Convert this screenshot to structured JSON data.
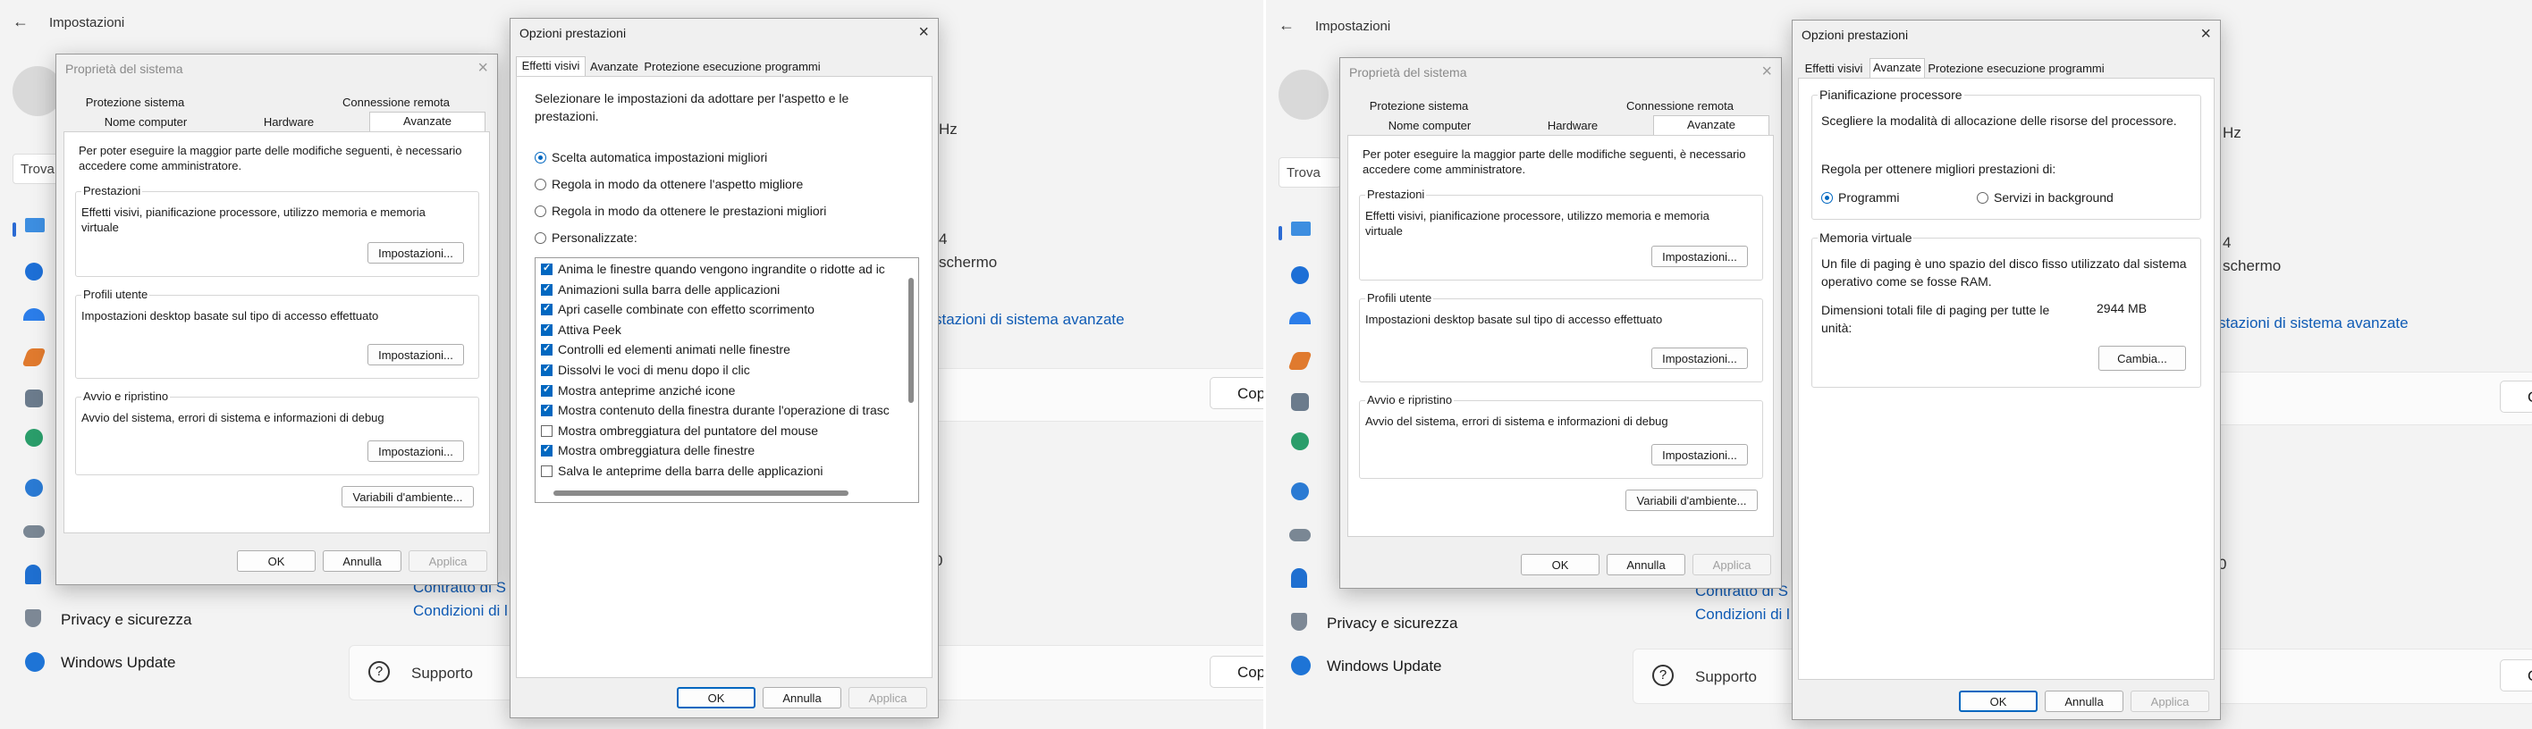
{
  "settings": {
    "title": "Impostazioni",
    "search_text": "Trova",
    "partial_hz": "Hz",
    "partial_4": "4",
    "partial_schermo": "schermo",
    "link_advanced": "stazioni di sistema avanzate",
    "copy_label": "Copi",
    "copy_label_short": "C",
    "partial_0": "0",
    "link_contract": "Contratto di S",
    "link_conditions": "Condizioni di l",
    "nav": {
      "privacy": "Privacy e sicurezza",
      "update": "Windows Update",
      "support": "Supporto"
    }
  },
  "system_properties": {
    "title": "Proprietà del sistema",
    "tabs": {
      "protection": "Protezione sistema",
      "remote": "Connessione remota",
      "computer_name": "Nome computer",
      "hardware": "Hardware",
      "advanced": "Avanzate"
    },
    "admin_note": "Per poter eseguire la maggior parte delle modifiche seguenti, è necessario accedere come amministratore.",
    "performance": {
      "label": "Prestazioni",
      "desc": "Effetti visivi, pianificazione processore, utilizzo memoria e memoria virtuale",
      "button": "Impostazioni..."
    },
    "user_profiles": {
      "label": "Profili utente",
      "desc": "Impostazioni desktop basate sul tipo di accesso effettuato",
      "button": "Impostazioni..."
    },
    "startup": {
      "label": "Avvio e ripristino",
      "desc": "Avvio del sistema, errori di sistema e informazioni di debug",
      "button": "Impostazioni..."
    },
    "env_button": "Variabili d'ambiente...",
    "ok": "OK",
    "cancel": "Annulla",
    "apply": "Applica"
  },
  "performance_options": {
    "title": "Opzioni prestazioni",
    "tabs": {
      "visual": "Effetti visivi",
      "advanced": "Avanzate",
      "dep": "Protezione esecuzione programmi"
    },
    "visual": {
      "intro": "Selezionare le impostazioni da adottare per l'aspetto e le prestazioni.",
      "radio_auto": "Scelta automatica impostazioni migliori",
      "radio_look": "Regola in modo da ottenere l'aspetto migliore",
      "radio_perf": "Regola in modo da ottenere le prestazioni migliori",
      "radio_custom": "Personalizzate:",
      "items": [
        {
          "label": "Anima le finestre quando vengono ingrandite o ridotte ad ic",
          "checked": true
        },
        {
          "label": "Animazioni sulla barra delle applicazioni",
          "checked": true
        },
        {
          "label": "Apri caselle combinate con effetto scorrimento",
          "checked": true
        },
        {
          "label": "Attiva Peek",
          "checked": true
        },
        {
          "label": "Controlli ed elementi animati nelle finestre",
          "checked": true
        },
        {
          "label": "Dissolvi le voci di menu dopo il clic",
          "checked": true
        },
        {
          "label": "Mostra anteprime anziché icone",
          "checked": true
        },
        {
          "label": "Mostra contenuto della finestra durante l'operazione di trasc",
          "checked": true
        },
        {
          "label": "Mostra ombreggiatura del puntatore del mouse",
          "checked": false
        },
        {
          "label": "Mostra ombreggiatura delle finestre",
          "checked": true
        },
        {
          "label": "Salva le anteprime della barra delle applicazioni",
          "checked": false
        }
      ]
    },
    "advanced": {
      "scheduling_label": "Pianificazione processore",
      "scheduling_desc": "Scegliere la modalità di allocazione delle risorse del processore.",
      "adjust_for": "Regola per ottenere migliori prestazioni di:",
      "radio_programs": "Programmi",
      "radio_background": "Servizi in background",
      "vm_label": "Memoria virtuale",
      "vm_desc": "Un file di paging è uno spazio del disco fisso utilizzato dal sistema operativo come se fosse RAM.",
      "vm_total_label": "Dimensioni totali file di paging per tutte le unità:",
      "vm_total_value": "2944 MB",
      "change_button": "Cambia..."
    },
    "ok": "OK",
    "cancel": "Annulla",
    "apply": "Applica"
  },
  "colors": {
    "accent": "#0067c0",
    "link": "#0f5bb5"
  }
}
